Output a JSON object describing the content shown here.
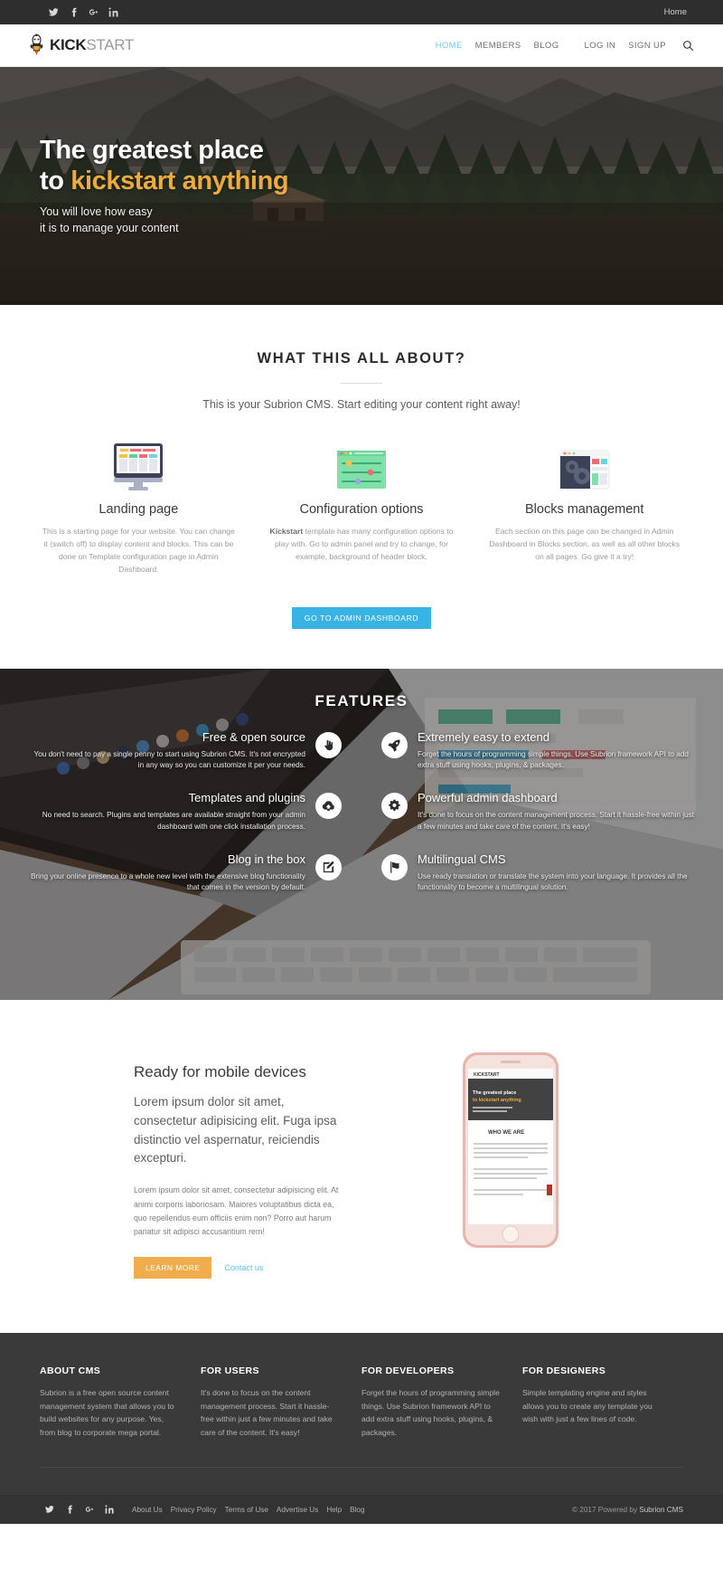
{
  "topbar": {
    "social": [
      {
        "name": "twitter-icon",
        "label": "Twitter"
      },
      {
        "name": "facebook-icon",
        "label": "Facebook"
      },
      {
        "name": "google-plus-icon",
        "label": "Google Plus"
      },
      {
        "name": "linkedin-icon",
        "label": "LinkedIn"
      }
    ],
    "home_link": "Home"
  },
  "header": {
    "logo": {
      "bold": "KICK",
      "light": "START"
    },
    "nav": [
      {
        "label": "HOME",
        "active": true
      },
      {
        "label": "MEMBERS",
        "active": false
      },
      {
        "label": "BLOG",
        "active": false
      }
    ],
    "auth": [
      {
        "label": "LOG IN"
      },
      {
        "label": "SIGN UP"
      }
    ],
    "search_icon": "search-icon",
    "active_color": "#6fc9e8"
  },
  "hero": {
    "title_line1": "The greatest place",
    "title_line2_prefix": "to ",
    "title_line2_accent": "kickstart anything",
    "accent_color": "#edaa3f",
    "sub_line1": "You will love how easy",
    "sub_line2": "it is to manage your content"
  },
  "about": {
    "heading": "WHAT THIS ALL ABOUT?",
    "lead": "This is your Subrion CMS. Start editing your content right away!",
    "columns": [
      {
        "icon": "monitor-landing-page-icon",
        "title": "Landing page",
        "text": "This is a starting page for your website. You can change it (switch off) to display content and blocks. This can be done on Template configuration page in Admin Dashboard."
      },
      {
        "icon": "sliders-configuration-icon",
        "title": "Configuration options",
        "text_bold": "Kickstart",
        "text": " template has many configuration options to play with. Go to admin panel and try to change, for example, background of header block."
      },
      {
        "icon": "gears-blocks-icon",
        "title": "Blocks management",
        "text": "Each section on this page can be changed in Admin Dashboard in Blocks section, as well as all other blocks on all pages. Go give it a try!"
      }
    ],
    "cta_label": "GO TO ADMIN DASHBOARD",
    "cta_color": "#39b3e4"
  },
  "features": {
    "heading": "FEATURES",
    "items": [
      {
        "side": "left",
        "icon": "hand-pointer-icon",
        "title": "Free & open source",
        "text": "You don't need to pay a single penny to start using Subrion CMS. It's not encrypted in any way so you can customize it per your needs."
      },
      {
        "side": "right",
        "icon": "rocket-icon",
        "title": "Extremely easy to extend",
        "text": "Forget the hours of programming simple things. Use Subrion framework API to add extra stuff using hooks, plugins, & packages."
      },
      {
        "side": "left",
        "icon": "cloud-download-icon",
        "title": "Templates and plugins",
        "text": "No need to search. Plugins and templates are available straight from your admin dashboard with one click installation process."
      },
      {
        "side": "right",
        "icon": "cogs-icon",
        "title": "Powerful admin dashboard",
        "text": "It's done to focus on the content management process. Start it hassle-free within just a few minutes and take care of the content. It's easy!"
      },
      {
        "side": "left",
        "icon": "pencil-square-icon",
        "title": "Blog in the box",
        "text": "Bring your online presence to a whole new level with the extensive blog functionality that comes in the version by default."
      },
      {
        "side": "right",
        "icon": "flag-icon",
        "title": "Multilingual CMS",
        "text": "Use ready translation or translate the system into your language. It provides all the functionality to become a multilingual solution."
      }
    ]
  },
  "mobile": {
    "heading": "Ready for mobile devices",
    "big_text": "Lorem ipsum dolor sit amet, consectetur adipisicing elit. Fuga ipsa distinctio vel aspernatur, reiciendis excepturi.",
    "small_text": "Lorem ipsum dolor sit amet, consectetur adipisicing elit. At animi corporis laboriosam. Maiores voluptatibus dicta ea, quo repellendus eum officiis enim non? Porro aut harum pariatur sit adipisci accusantium rem!",
    "learn_more_label": "LEARN MORE",
    "contact_label": "Contact us",
    "learn_more_color": "#f0ad4e",
    "contact_color": "#5bc0de",
    "phone_screen": {
      "logo": "KICKSTART",
      "hero": "The greatest place to kickstart anything",
      "section": "WHO WE ARE"
    }
  },
  "footer": {
    "columns": [
      {
        "title": "ABOUT CMS",
        "text": "Subrion is a free open source content management system that allows you to build websites for any purpose. Yes, from blog to corporate mega portal."
      },
      {
        "title": "FOR USERS",
        "text": "It's done to focus on the content management process. Start it hassle-free within just a few minutes and take care of the content. It's easy!"
      },
      {
        "title": "FOR DEVELOPERS",
        "text": "Forget the hours of programming simple things. Use Subrion framework API to add extra stuff using hooks, plugins, & packages."
      },
      {
        "title": "FOR DESIGNERS",
        "text": "Simple templating engine and styles allows you to create any template you wish with just a few lines of code."
      }
    ],
    "social": [
      {
        "name": "twitter-icon",
        "label": "Twitter"
      },
      {
        "name": "facebook-icon",
        "label": "Facebook"
      },
      {
        "name": "google-plus-icon",
        "label": "Google Plus"
      },
      {
        "name": "linkedin-icon",
        "label": "LinkedIn"
      }
    ],
    "links": [
      "About Us",
      "Privacy Policy",
      "Terms of Use",
      "Advertise Us",
      "Help",
      "Blog"
    ],
    "copyright_prefix": "© 2017 Powered by ",
    "copyright_brand": "Subrion CMS"
  }
}
